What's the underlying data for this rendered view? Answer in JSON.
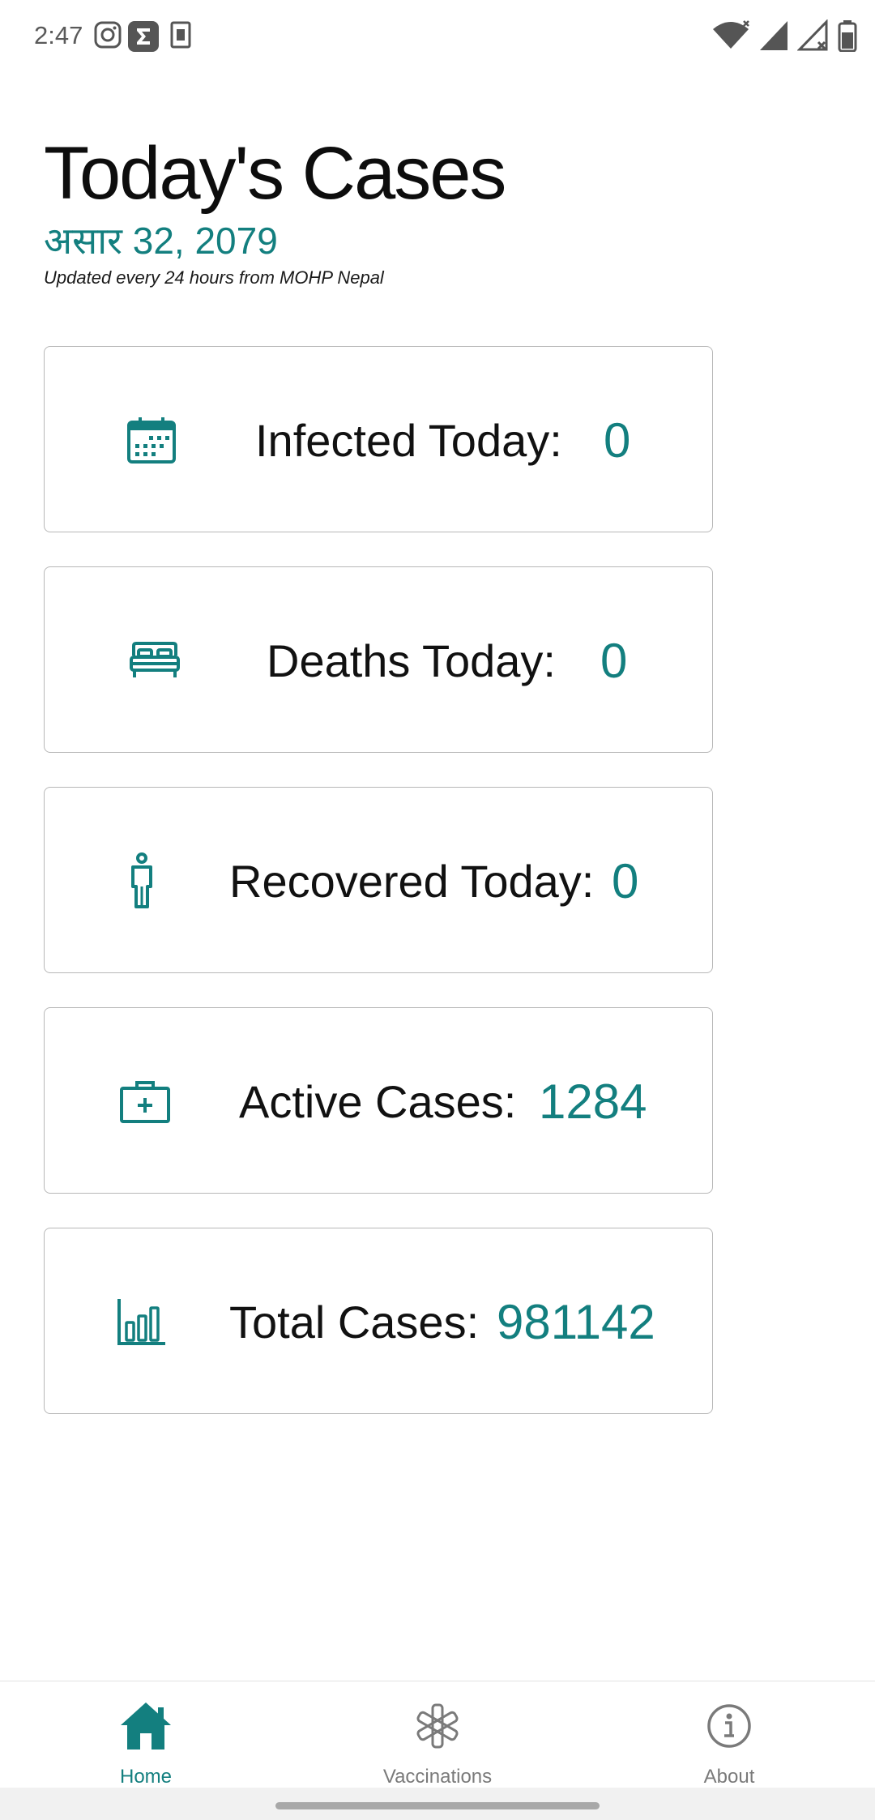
{
  "status_bar": {
    "time": "2:47",
    "notification_icons": [
      "instagram-icon",
      "sigma-icon",
      "sim-card-icon"
    ],
    "system_icons": [
      "wifi-icon",
      "signal-icon",
      "signal-off-icon",
      "battery-icon"
    ]
  },
  "header": {
    "title": "Today's Cases",
    "date": "असार 32, 2079",
    "subtitle": "Updated every 24 hours from MOHP Nepal"
  },
  "stats": [
    {
      "icon": "calendar-icon",
      "label": "Infected Today:",
      "value": "0"
    },
    {
      "icon": "bed-icon",
      "label": "Deaths Today:",
      "value": "0"
    },
    {
      "icon": "person-icon",
      "label": "Recovered Today:",
      "value": "0"
    },
    {
      "icon": "medical-kit-icon",
      "label": "Active Cases:",
      "value": "1284"
    },
    {
      "icon": "bar-chart-icon",
      "label": "Total Cases:",
      "value": "981142"
    }
  ],
  "bottom_nav": {
    "items": [
      {
        "icon": "home-icon",
        "label": "Home",
        "active": true
      },
      {
        "icon": "asterisk-icon",
        "label": "Vaccinations",
        "active": false
      },
      {
        "icon": "info-icon",
        "label": "About",
        "active": false
      }
    ]
  },
  "colors": {
    "accent": "#137f7f",
    "inactive": "#7a7a7a",
    "border": "#b7b7b7"
  }
}
